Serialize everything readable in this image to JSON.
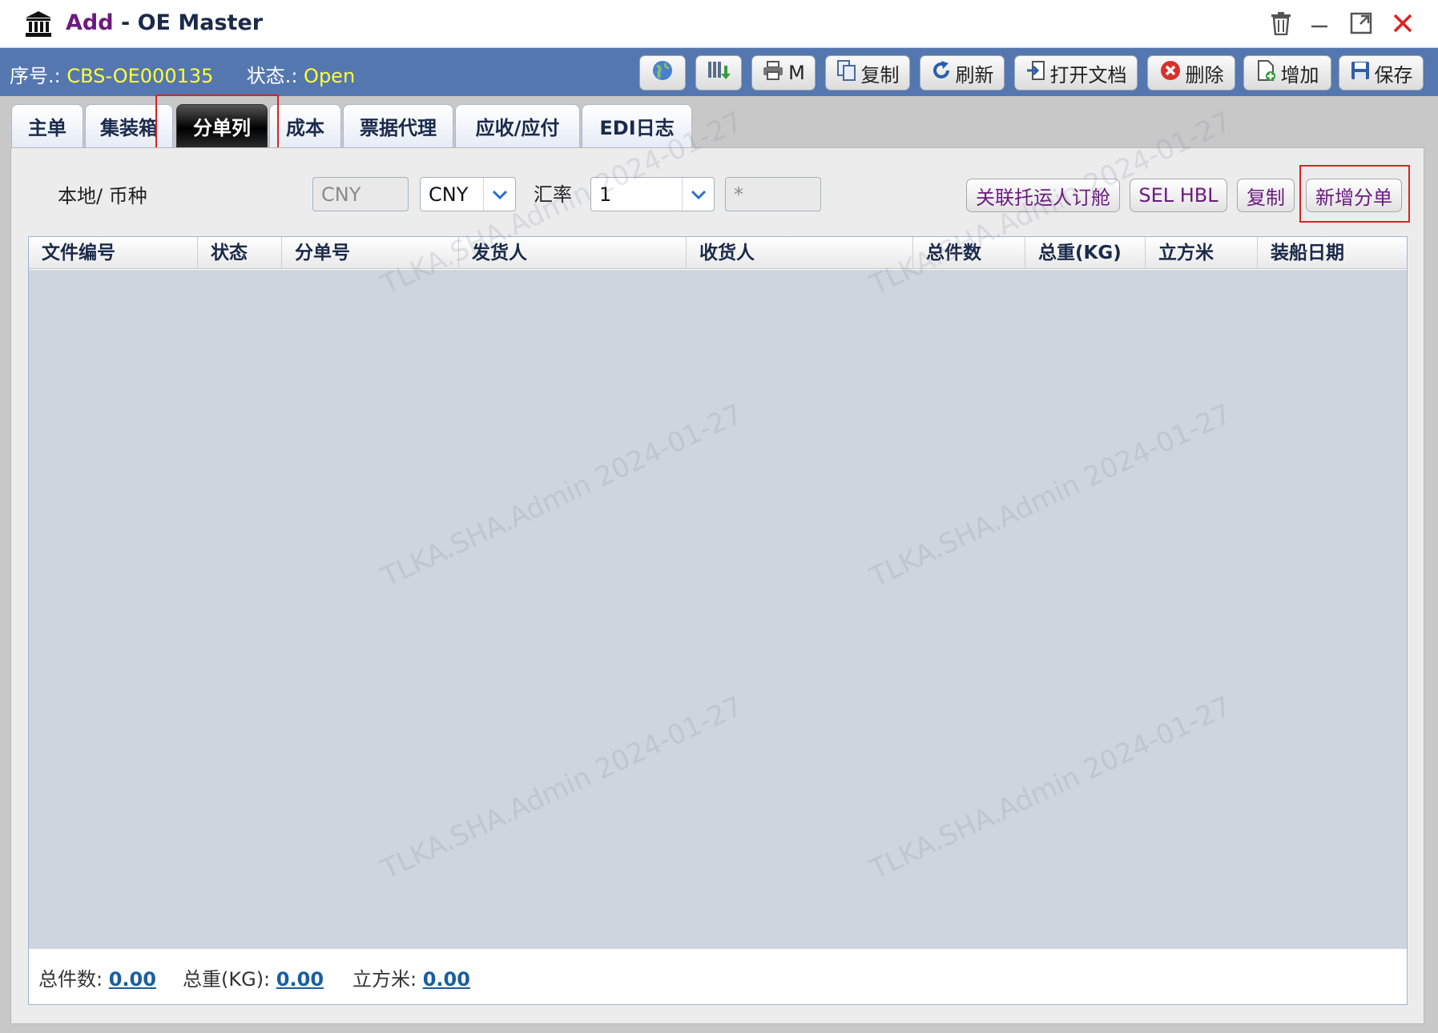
{
  "window": {
    "mode": "Add",
    "separator": " - ",
    "title": "OE Master"
  },
  "info": {
    "seq_label": "序号.:",
    "seq_value": "CBS-OE000135",
    "status_label": "状态.:",
    "status_value": "Open"
  },
  "toolbar": {
    "print_label": "M",
    "copy_label": "复制",
    "refresh_label": "刷新",
    "open_doc_label": "打开文档",
    "delete_label": "删除",
    "add_label": "增加",
    "save_label": "保存"
  },
  "tabs": [
    {
      "label": "主单"
    },
    {
      "label": "集装箱"
    },
    {
      "label": "分单列"
    },
    {
      "label": "成本"
    },
    {
      "label": "票据代理"
    },
    {
      "label": "应收/应付"
    },
    {
      "label": "EDI日志"
    }
  ],
  "filters": {
    "currency_label": "本地/ 币种",
    "local_currency": "CNY",
    "currency": "CNY",
    "rate_label": "汇率",
    "rate_value": "1",
    "extra_value": "*"
  },
  "actions": {
    "link_booking": "关联托运人订舱",
    "sel_hbl": "SEL HBL",
    "copy": "复制",
    "add_house": "新增分单"
  },
  "grid": {
    "columns": [
      "文件编号",
      "状态",
      "分单号",
      "发货人",
      "收货人",
      "总件数",
      "总重(KG)",
      "立方米",
      "装船日期"
    ]
  },
  "totals": {
    "pieces_label": "总件数:",
    "pieces_value": "0.00",
    "weight_label": "总重(KG):",
    "weight_value": "0.00",
    "volume_label": "立方米:",
    "volume_value": "0.00"
  },
  "watermark": "TLKA.SHA.Admin 2024-01-27",
  "colors": {
    "band": "#5577b0",
    "highlight_value": "#ffff3a",
    "action_text": "#6b1a80",
    "red_marker": "#e02020"
  }
}
